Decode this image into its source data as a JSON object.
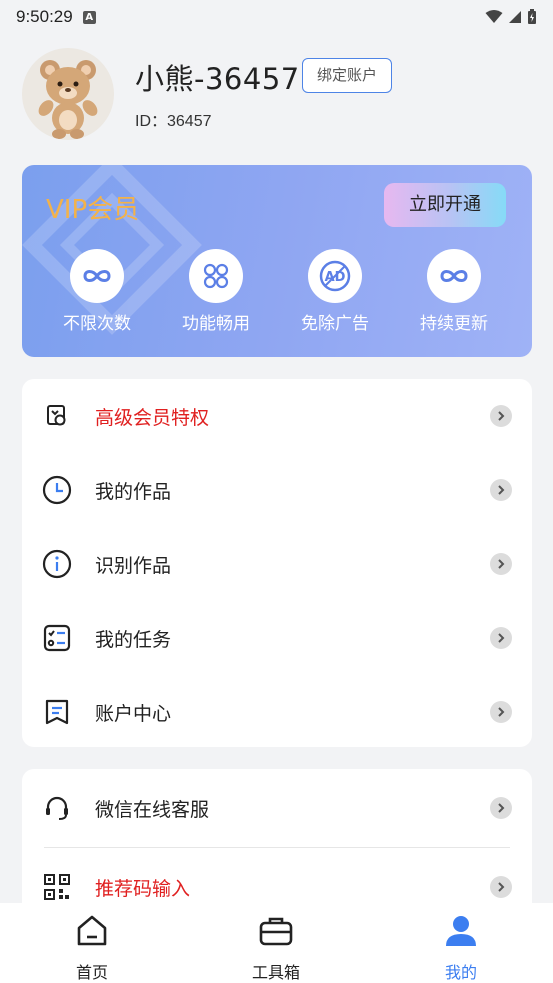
{
  "status_bar": {
    "time": "9:50:29",
    "notification_icon": "A"
  },
  "profile": {
    "username": "小熊-36457",
    "bind_label": "绑定账户",
    "user_id": "ID：36457"
  },
  "vip": {
    "title": "VIP会员",
    "open_label": "立即开通",
    "perks": [
      {
        "label": "不限次数",
        "icon": "infinity-icon"
      },
      {
        "label": "功能畅用",
        "icon": "grid-icon"
      },
      {
        "label": "免除广告",
        "icon": "ad-icon"
      },
      {
        "label": "持续更新",
        "icon": "infinity-icon"
      }
    ]
  },
  "menu": [
    {
      "label": "高级会员特权",
      "icon": "vip-privilege-icon",
      "highlight": true
    },
    {
      "label": "我的作品",
      "icon": "clock-icon"
    },
    {
      "label": "识别作品",
      "icon": "info-icon"
    },
    {
      "label": "我的任务",
      "icon": "checklist-icon"
    },
    {
      "label": "账户中心",
      "icon": "bookmark-icon"
    }
  ],
  "menu2": [
    {
      "label": "微信在线客服",
      "icon": "headset-icon"
    },
    {
      "label": "推荐码输入",
      "icon": "qr-code-icon",
      "highlight": true
    }
  ],
  "nav": [
    {
      "label": "首页",
      "icon": "home-icon"
    },
    {
      "label": "工具箱",
      "icon": "toolbox-icon"
    },
    {
      "label": "我的",
      "icon": "user-icon",
      "active": true
    }
  ],
  "colors": {
    "accent": "#3c7ef0",
    "vip_gold": "#f3b24a",
    "highlight_red": "#e02020"
  }
}
